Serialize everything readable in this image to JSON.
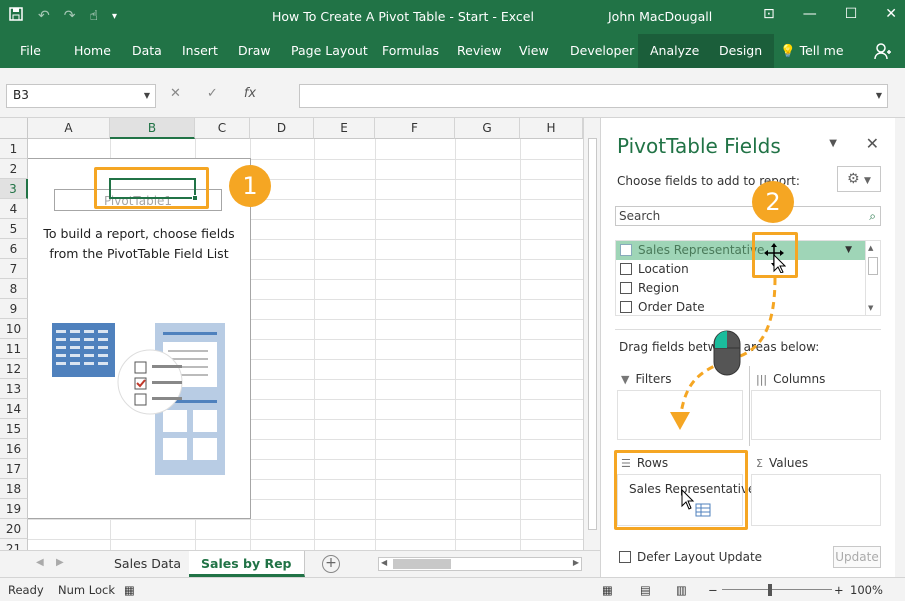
{
  "window": {
    "title": "How To Create A Pivot Table - Start  -  Excel",
    "user": "John MacDougall"
  },
  "ribbon": {
    "tabs": [
      "File",
      "Home",
      "Data",
      "Insert",
      "Draw",
      "Page Layout",
      "Formulas",
      "Review",
      "View",
      "Developer",
      "Analyze",
      "Design"
    ],
    "tell_me": "Tell me"
  },
  "formula_bar": {
    "name_box": "B3",
    "fx": "fx",
    "value": ""
  },
  "grid": {
    "columns": [
      "A",
      "B",
      "C",
      "D",
      "E",
      "F",
      "G",
      "H"
    ],
    "rows": [
      "1",
      "2",
      "3",
      "4",
      "5",
      "6",
      "7",
      "8",
      "9",
      "10",
      "11",
      "12",
      "13",
      "14",
      "15",
      "16",
      "17",
      "18",
      "19",
      "20",
      "21"
    ],
    "selected_col": "B",
    "selected_row": "3"
  },
  "pivot_placeholder": {
    "name": "PivotTable1",
    "message_line1": "To build a report, choose fields",
    "message_line2": "from the PivotTable Field List"
  },
  "callouts": [
    "1",
    "2"
  ],
  "sheets": {
    "tabs": [
      "Sales Data",
      "Sales by Rep"
    ],
    "active": "Sales by Rep"
  },
  "status": {
    "ready": "Ready",
    "num_lock": "Num Lock",
    "zoom": "100%"
  },
  "pane": {
    "title": "PivotTable Fields",
    "subtitle": "Choose fields to add to report:",
    "search_placeholder": "Search",
    "fields": [
      "Sales Representative",
      "Location",
      "Region",
      "Order Date"
    ],
    "drag_hint": "Drag fields between areas below:",
    "areas": {
      "filters": "Filters",
      "columns": "Columns",
      "rows": "Rows",
      "values": "Values"
    },
    "rows_items": [
      "Sales Representative"
    ],
    "defer_label": "Defer Layout Update",
    "update_button": "Update"
  },
  "colors": {
    "excel_green": "#217346",
    "highlight_orange": "#f5a623",
    "field_hover": "#9fd5b7"
  }
}
